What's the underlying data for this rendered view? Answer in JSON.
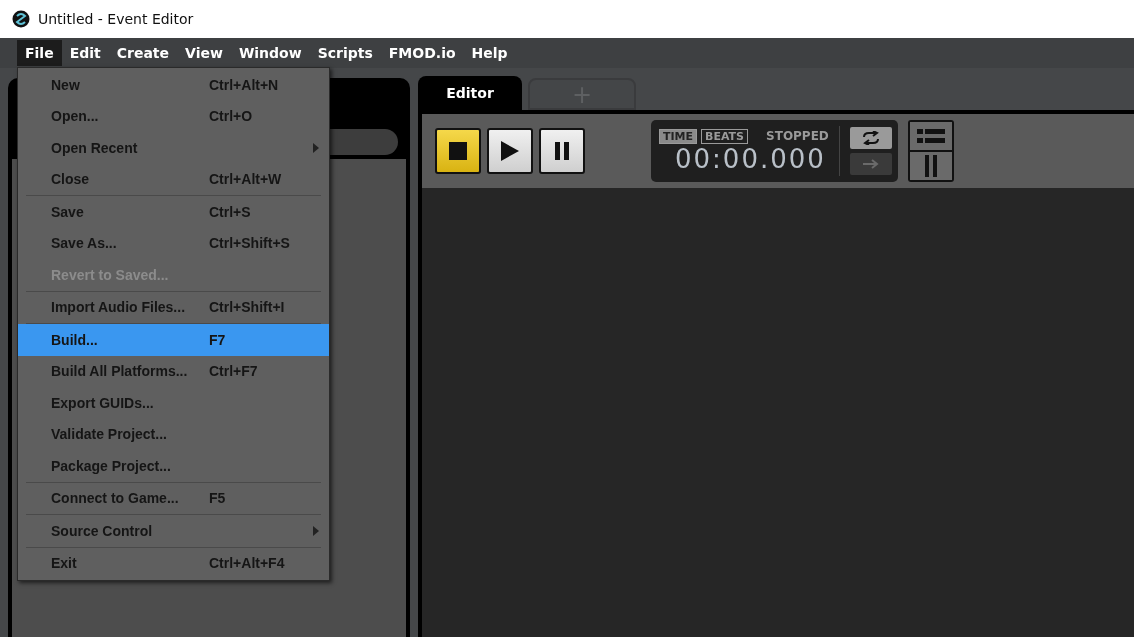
{
  "window": {
    "title": "Untitled - Event Editor"
  },
  "menubar": [
    {
      "label": "File",
      "selected": true
    },
    {
      "label": "Edit",
      "selected": false
    },
    {
      "label": "Create",
      "selected": false
    },
    {
      "label": "View",
      "selected": false
    },
    {
      "label": "Window",
      "selected": false
    },
    {
      "label": "Scripts",
      "selected": false
    },
    {
      "label": "FMOD.io",
      "selected": false
    },
    {
      "label": "Help",
      "selected": false
    }
  ],
  "file_menu": {
    "groups": [
      [
        {
          "label": "New",
          "shortcut": "Ctrl+Alt+N",
          "submenu": false,
          "disabled": false,
          "selected": false
        },
        {
          "label": "Open...",
          "shortcut": "Ctrl+O",
          "submenu": false,
          "disabled": false,
          "selected": false
        },
        {
          "label": "Open Recent",
          "submenu": true,
          "disabled": false,
          "selected": false
        },
        {
          "label": "Close",
          "shortcut": "Ctrl+Alt+W",
          "submenu": false,
          "disabled": false,
          "selected": false
        }
      ],
      [
        {
          "label": "Save",
          "shortcut": "Ctrl+S",
          "submenu": false,
          "disabled": false,
          "selected": false
        },
        {
          "label": "Save As...",
          "shortcut": "Ctrl+Shift+S",
          "submenu": false,
          "disabled": false,
          "selected": false
        },
        {
          "label": "Revert to Saved...",
          "submenu": false,
          "disabled": true,
          "selected": false
        }
      ],
      [
        {
          "label": "Import Audio Files...",
          "shortcut": "Ctrl+Shift+I",
          "submenu": false,
          "disabled": false,
          "selected": false
        }
      ],
      [
        {
          "label": "Build...",
          "shortcut": "F7",
          "submenu": false,
          "disabled": false,
          "selected": true
        },
        {
          "label": "Build All Platforms...",
          "shortcut": "Ctrl+F7",
          "submenu": false,
          "disabled": false,
          "selected": false
        },
        {
          "label": "Export GUIDs...",
          "submenu": false,
          "disabled": false,
          "selected": false
        },
        {
          "label": "Validate Project...",
          "submenu": false,
          "disabled": false,
          "selected": false
        },
        {
          "label": "Package Project...",
          "submenu": false,
          "disabled": false,
          "selected": false
        }
      ],
      [
        {
          "label": "Connect to Game...",
          "shortcut": "F5",
          "submenu": false,
          "disabled": false,
          "selected": false
        }
      ],
      [
        {
          "label": "Source Control",
          "submenu": true,
          "disabled": false,
          "selected": false
        }
      ],
      [
        {
          "label": "Exit",
          "shortcut": "Ctrl+Alt+F4",
          "submenu": false,
          "disabled": false,
          "selected": false
        }
      ]
    ]
  },
  "tabs": [
    {
      "kind": "label",
      "label": "Editor",
      "selected": true
    },
    {
      "kind": "add",
      "label": "+",
      "selected": false
    }
  ],
  "transport": [
    {
      "kind": "stop",
      "active": true
    },
    {
      "kind": "play",
      "active": false
    },
    {
      "kind": "pause",
      "active": false
    }
  ],
  "time_display": {
    "modes": [
      {
        "label": "TIME",
        "selected": true
      },
      {
        "label": "BEATS",
        "selected": false
      }
    ],
    "status": "STOPPED",
    "time": "00:00.000",
    "loop": {
      "on": true
    },
    "follow": {
      "on": false
    }
  },
  "view_buttons": [
    {
      "kind": "list"
    },
    {
      "kind": "pause"
    }
  ]
}
